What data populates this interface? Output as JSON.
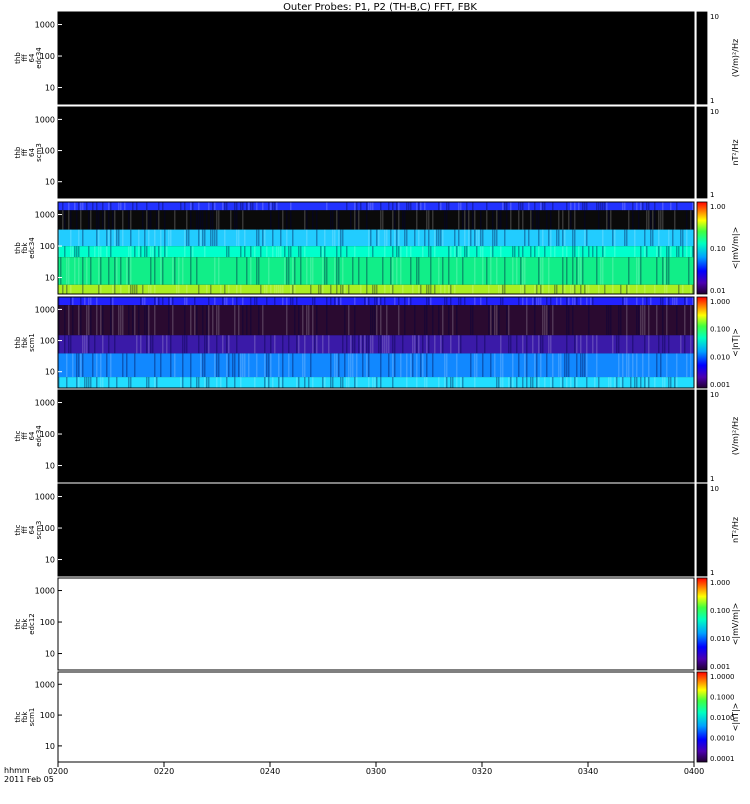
{
  "title": "Outer Probes: P1, P2 (TH-B,C) FFT, FBK",
  "time_axis": {
    "label_line1": "hhmm",
    "label_line2": "2011 Feb 05",
    "ticks": [
      "0200",
      "0220",
      "0240",
      "0300",
      "0320",
      "0340",
      "0400"
    ]
  },
  "chart_data": [
    {
      "type": "heatmap",
      "panel_label": [
        "thb",
        "fff",
        "64",
        "edc34"
      ],
      "y_ticks": [
        "1000",
        "100",
        "10"
      ],
      "y_log": true,
      "colorbar": {
        "ticks": [
          "10",
          "1"
        ],
        "label": "(V/m)²/Hz",
        "scheme": "black"
      },
      "fill": "no data (black)"
    },
    {
      "type": "heatmap",
      "panel_label": [
        "thb",
        "fff",
        "64",
        "scm3"
      ],
      "y_ticks": [
        "1000",
        "100",
        "10"
      ],
      "y_log": true,
      "colorbar": {
        "ticks": [
          "10",
          "1"
        ],
        "label": "nT²/Hz",
        "scheme": "black"
      },
      "fill": "no data (black)"
    },
    {
      "type": "heatmap",
      "panel_label": [
        "thb",
        "fbk",
        "edc34"
      ],
      "y_ticks": [
        "1000",
        "100",
        "10"
      ],
      "y_log": true,
      "colorbar": {
        "ticks": [
          "1.00",
          "0.10",
          "0.01"
        ],
        "label": "<|mV/m|>",
        "scheme": "rainbow"
      },
      "bands": [
        {
          "from": 0.0,
          "to": 0.09,
          "color": "#2233ff"
        },
        {
          "from": 0.09,
          "to": 0.3,
          "color": "#0a0a0a"
        },
        {
          "from": 0.3,
          "to": 0.48,
          "color": "#22ccff"
        },
        {
          "from": 0.48,
          "to": 0.6,
          "color": "#00ffcc"
        },
        {
          "from": 0.6,
          "to": 0.9,
          "color": "#11ee88"
        },
        {
          "from": 0.9,
          "to": 1.0,
          "color": "#aaee22"
        }
      ]
    },
    {
      "type": "heatmap",
      "panel_label": [
        "thb",
        "fbk",
        "scm1"
      ],
      "y_ticks": [
        "1000",
        "100",
        "10"
      ],
      "y_log": true,
      "colorbar": {
        "ticks": [
          "1.000",
          "0.100",
          "0.010",
          "0.001"
        ],
        "label": "<|nT|>",
        "scheme": "rainbow"
      },
      "bands": [
        {
          "from": 0.0,
          "to": 0.09,
          "color": "#2222ff"
        },
        {
          "from": 0.09,
          "to": 0.42,
          "color": "#2a0a30"
        },
        {
          "from": 0.42,
          "to": 0.62,
          "color": "#3a1aa8"
        },
        {
          "from": 0.62,
          "to": 0.88,
          "color": "#1188ff"
        },
        {
          "from": 0.88,
          "to": 1.0,
          "color": "#22ddff"
        }
      ]
    },
    {
      "type": "heatmap",
      "panel_label": [
        "thc",
        "fff",
        "64",
        "edc34"
      ],
      "y_ticks": [
        "1000",
        "100",
        "10"
      ],
      "y_log": true,
      "colorbar": {
        "ticks": [
          "10",
          "1"
        ],
        "label": "(V/m)²/Hz",
        "scheme": "black"
      },
      "fill": "no data (black)"
    },
    {
      "type": "heatmap",
      "panel_label": [
        "thc",
        "fff",
        "64",
        "scm3"
      ],
      "y_ticks": [
        "1000",
        "100",
        "10"
      ],
      "y_log": true,
      "colorbar": {
        "ticks": [
          "10",
          "1"
        ],
        "label": "nT²/Hz",
        "scheme": "black"
      },
      "fill": "no data (black)"
    },
    {
      "type": "heatmap",
      "panel_label": [
        "thc",
        "fbk",
        "edc12"
      ],
      "y_ticks": [
        "1000",
        "100",
        "10"
      ],
      "y_log": true,
      "colorbar": {
        "ticks": [
          "1.000",
          "0.100",
          "0.010",
          "0.001"
        ],
        "label": "<|mV/m|>",
        "scheme": "rainbow"
      },
      "fill": "no data (white)"
    },
    {
      "type": "heatmap",
      "panel_label": [
        "thc",
        "fbk",
        "scm1"
      ],
      "y_ticks": [
        "1000",
        "100",
        "10"
      ],
      "y_log": true,
      "colorbar": {
        "ticks": [
          "1.0000",
          "0.1000",
          "0.0100",
          "0.0010",
          "0.0001"
        ],
        "label": "<|nT|>",
        "scheme": "rainbow"
      },
      "fill": "no data (white)"
    }
  ]
}
